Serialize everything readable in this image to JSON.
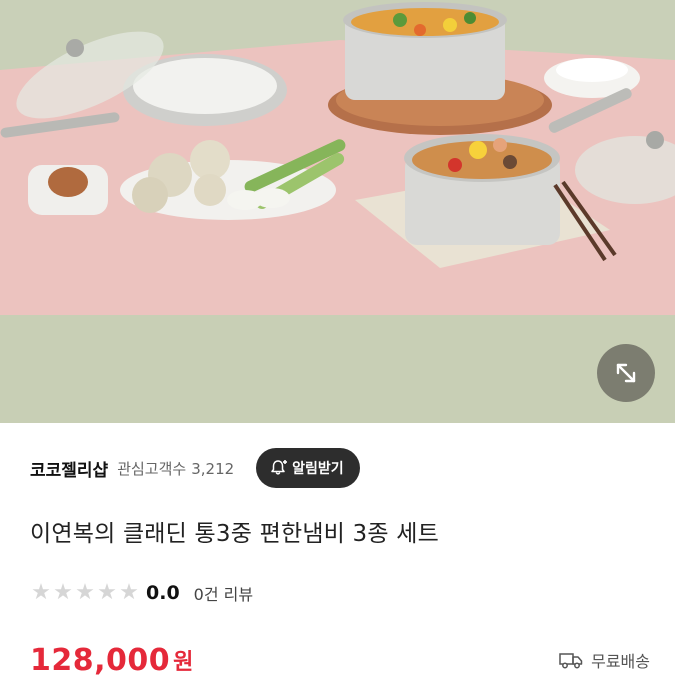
{
  "hero": {
    "image_alt": "스테인리스 냄비 3종 세트 제품 사진",
    "expand_icon": "expand-arrows-icon"
  },
  "seller": {
    "name": "코코젤리샵",
    "followers_label": "관심고객수",
    "followers_count": "3,212",
    "alarm_button_label": "알림받기",
    "alarm_icon": "bell-plus-icon"
  },
  "product": {
    "title": "이연복의 클래딘 통3중 편한냄비 3종 세트",
    "rating": {
      "score": "0.0",
      "stars_filled": 0,
      "stars_total": 5,
      "reviews_label": "0건 리뷰"
    },
    "price": {
      "amount": "128,000",
      "currency": "원"
    },
    "shipping": {
      "label": "무료배송",
      "icon": "truck-icon"
    }
  },
  "colors": {
    "price_red": "#e5293a",
    "button_dark": "#2d2d2d",
    "star_gray": "#d6d6d6"
  }
}
